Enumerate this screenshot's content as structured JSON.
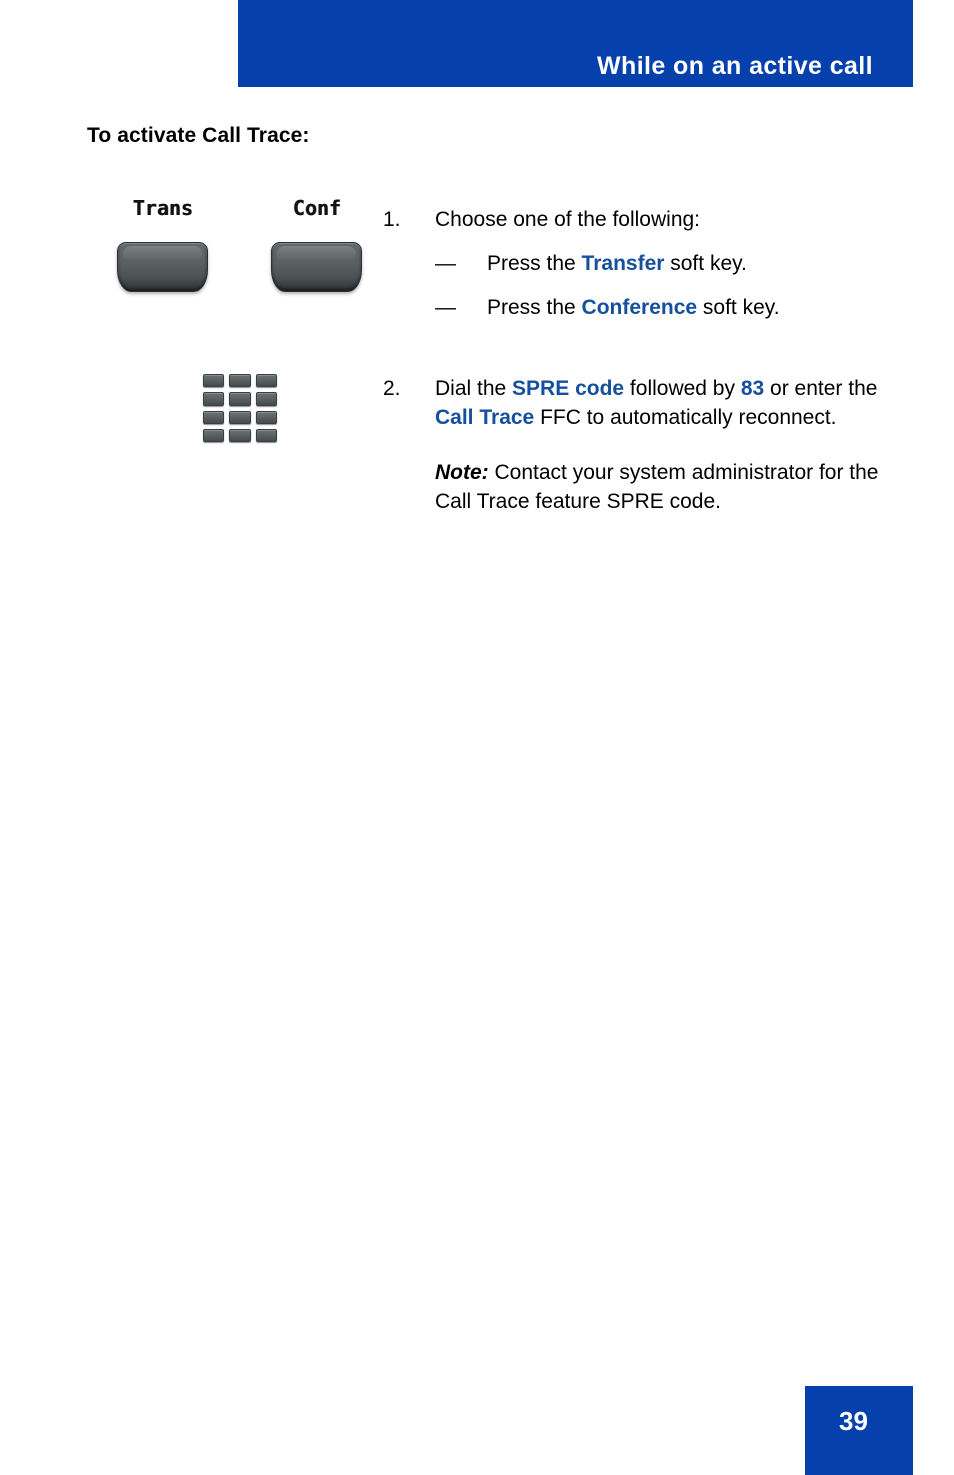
{
  "header": {
    "title": "While on an active call",
    "banner_color": "#0540ad"
  },
  "section": {
    "heading": "To activate Call Trace:"
  },
  "icons": {
    "softkey_trans_label": "Trans",
    "softkey_conf_label": "Conf",
    "keypad_name": "dialpad-icon"
  },
  "procedure": {
    "step1": {
      "number": "1.",
      "text": "Choose one of the following:",
      "bullets": [
        {
          "dash": "—",
          "pre": "Press the ",
          "emphasis": "Transfer",
          "post": " soft key."
        },
        {
          "dash": "—",
          "pre": "Press the ",
          "emphasis": "Conference",
          "post": " soft key."
        }
      ]
    },
    "step2": {
      "number": "2.",
      "part1": "Dial the ",
      "em1": "SPRE code",
      "part2": " followed by ",
      "em2": "83",
      "part3": " or enter the ",
      "em3": "Call Trace",
      "part4": " FFC to automatically reconnect.",
      "note_lead": "Note:",
      "note_text": " Contact your system administrator for the Call Trace feature SPRE code."
    }
  },
  "footer": {
    "page_number": "39",
    "box_color": "#0540ad"
  },
  "colors": {
    "brand_blue": "#0540ad",
    "link_blue": "#15509e",
    "text_black": "#000000"
  }
}
